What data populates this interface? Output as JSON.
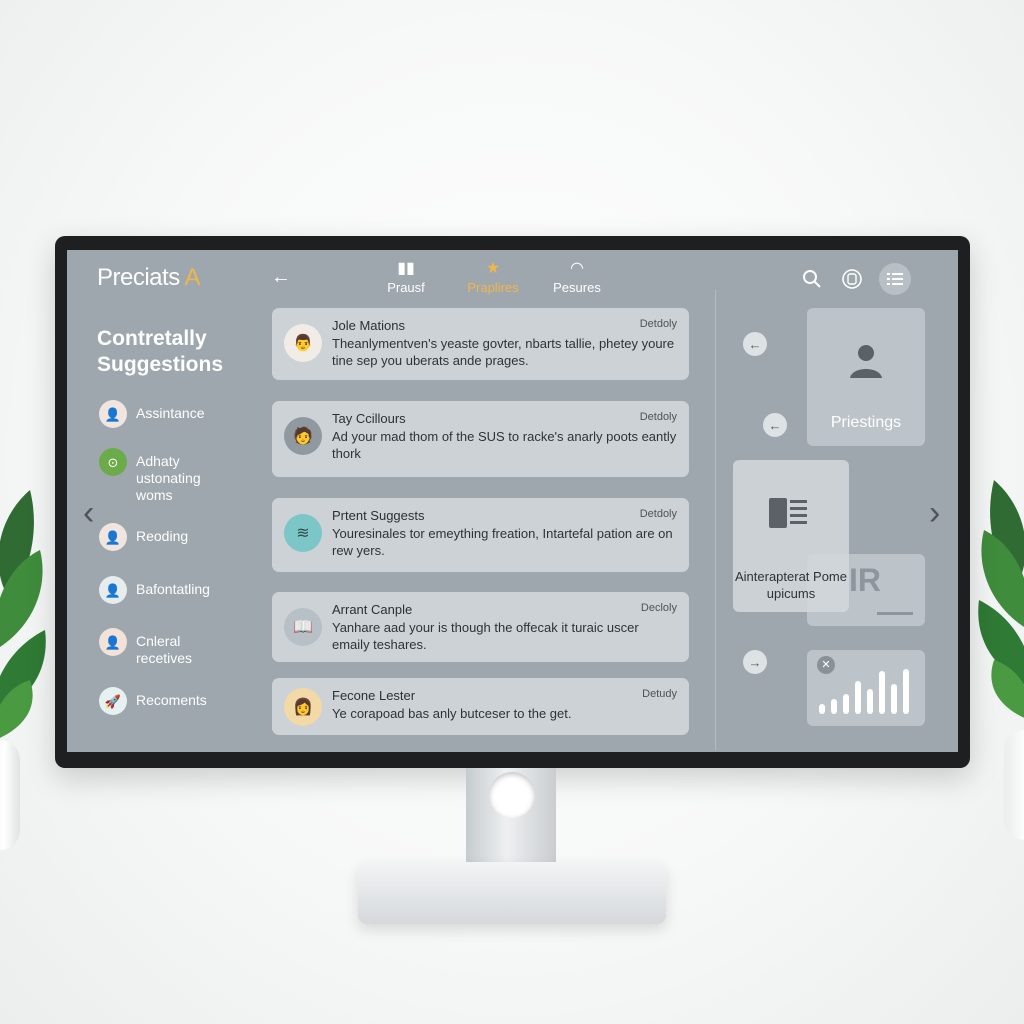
{
  "header": {
    "brand_main": "Preciats",
    "brand_accent": "A",
    "tabs": [
      {
        "label": "Prausf",
        "icon": "chart-bars-icon",
        "active": false
      },
      {
        "label": "Praplires",
        "icon": "star-icon",
        "active": true
      },
      {
        "label": "Pesures",
        "icon": "wifi-icon",
        "active": false
      }
    ],
    "accent_color": "#f2b54c"
  },
  "sidebar": {
    "title_line1": "Contretally",
    "title_line2": "Suggestions",
    "items": [
      {
        "label": "Assintance",
        "icon": "person-avatar"
      },
      {
        "label": "Adhaty ustonating woms",
        "icon": "green-badge-avatar"
      },
      {
        "label": "Reoding",
        "icon": "person-avatar"
      },
      {
        "label": "Bafontatling",
        "icon": "person-avatar"
      },
      {
        "label": "Cnleral recetives",
        "icon": "person-avatar"
      },
      {
        "label": "Recoments",
        "icon": "rocket-avatar"
      }
    ]
  },
  "messages": [
    {
      "name": "Jole Mations",
      "time": "Detdoly",
      "text": "Theanlymentven's yeaste govter, nbarts tallie, phetey youre tine sep you uberats ande prages."
    },
    {
      "name": "Tay Ccillours",
      "time": "Detdoly",
      "text": "Ad your mad thom of the SUS to racke's anarly poots eantly thork"
    },
    {
      "name": "Prtent Suggests",
      "time": "Detdoly",
      "text": "Youresinales tor emeything freation, Intartefal pation are on rew yers."
    },
    {
      "name": "Arrant Canple",
      "time": "Decloly",
      "text": "Yanhare aad your is though the offecak it turaic uscer emaily teshares."
    },
    {
      "name": "Fecone Lester",
      "time": "Detudy",
      "text": "Ye corapoad bas anly butceser to the get."
    }
  ],
  "right_panel": {
    "profile_label": "Priestings",
    "doc_label": "Ainterapterat Pome upicums",
    "ir_text": "IR",
    "chart_bars": [
      0.2,
      0.3,
      0.4,
      0.65,
      0.5,
      0.85,
      0.6,
      0.9
    ]
  }
}
